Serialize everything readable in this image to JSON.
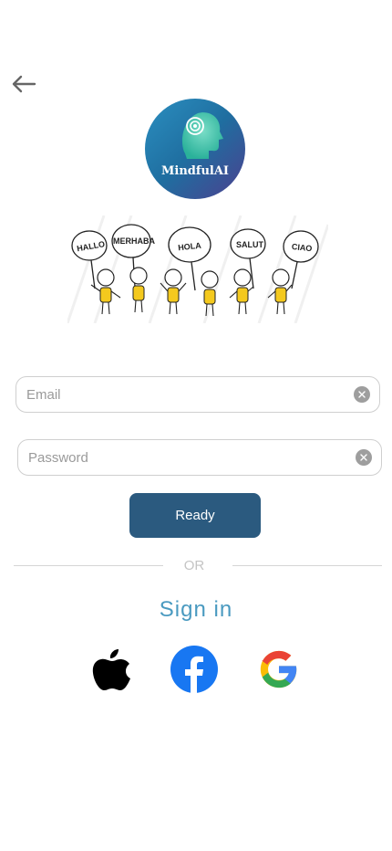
{
  "logo": {
    "name": "MindfulAI"
  },
  "illustration": {
    "signs": [
      "HALLO",
      "MERHABA",
      "HOLA",
      "SALUT",
      "CIAO"
    ]
  },
  "form": {
    "email_placeholder": "Email",
    "password_placeholder": "Password",
    "submit_label": "Ready"
  },
  "divider": {
    "label": "OR"
  },
  "signin": {
    "title": "Sign in"
  },
  "social": {
    "providers": [
      "apple",
      "facebook",
      "google"
    ]
  },
  "colors": {
    "primary_button": "#2b5a7f",
    "signin_title": "#4a9ac0",
    "facebook": "#1877f2"
  }
}
